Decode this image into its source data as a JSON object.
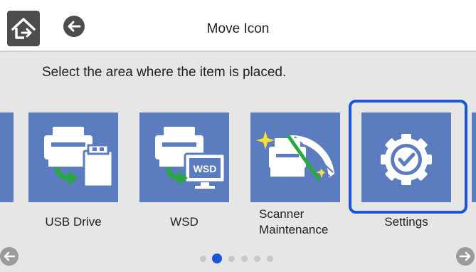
{
  "header": {
    "title": "Move Icon",
    "home_icon": "home-icon",
    "back_icon": "back-arrow-icon"
  },
  "instruction": "Select the area where the item is placed.",
  "tiles": [
    {
      "label": "USB Drive",
      "icon": "usb-drive-icon"
    },
    {
      "label": "WSD",
      "icon": "wsd-printer-icon"
    },
    {
      "label_line1": "Scanner",
      "label_line2": "Maintenance",
      "icon": "scanner-maintenance-icon"
    },
    {
      "label": "Settings",
      "icon": "settings-gear-icon",
      "selected": true
    }
  ],
  "pagination": {
    "pages": 6,
    "current": 2
  },
  "colors": {
    "tile": "#5b7cbe",
    "selection": "#1a56d6",
    "background": "#e6e6e6",
    "header_button": "#4d4d4d"
  }
}
